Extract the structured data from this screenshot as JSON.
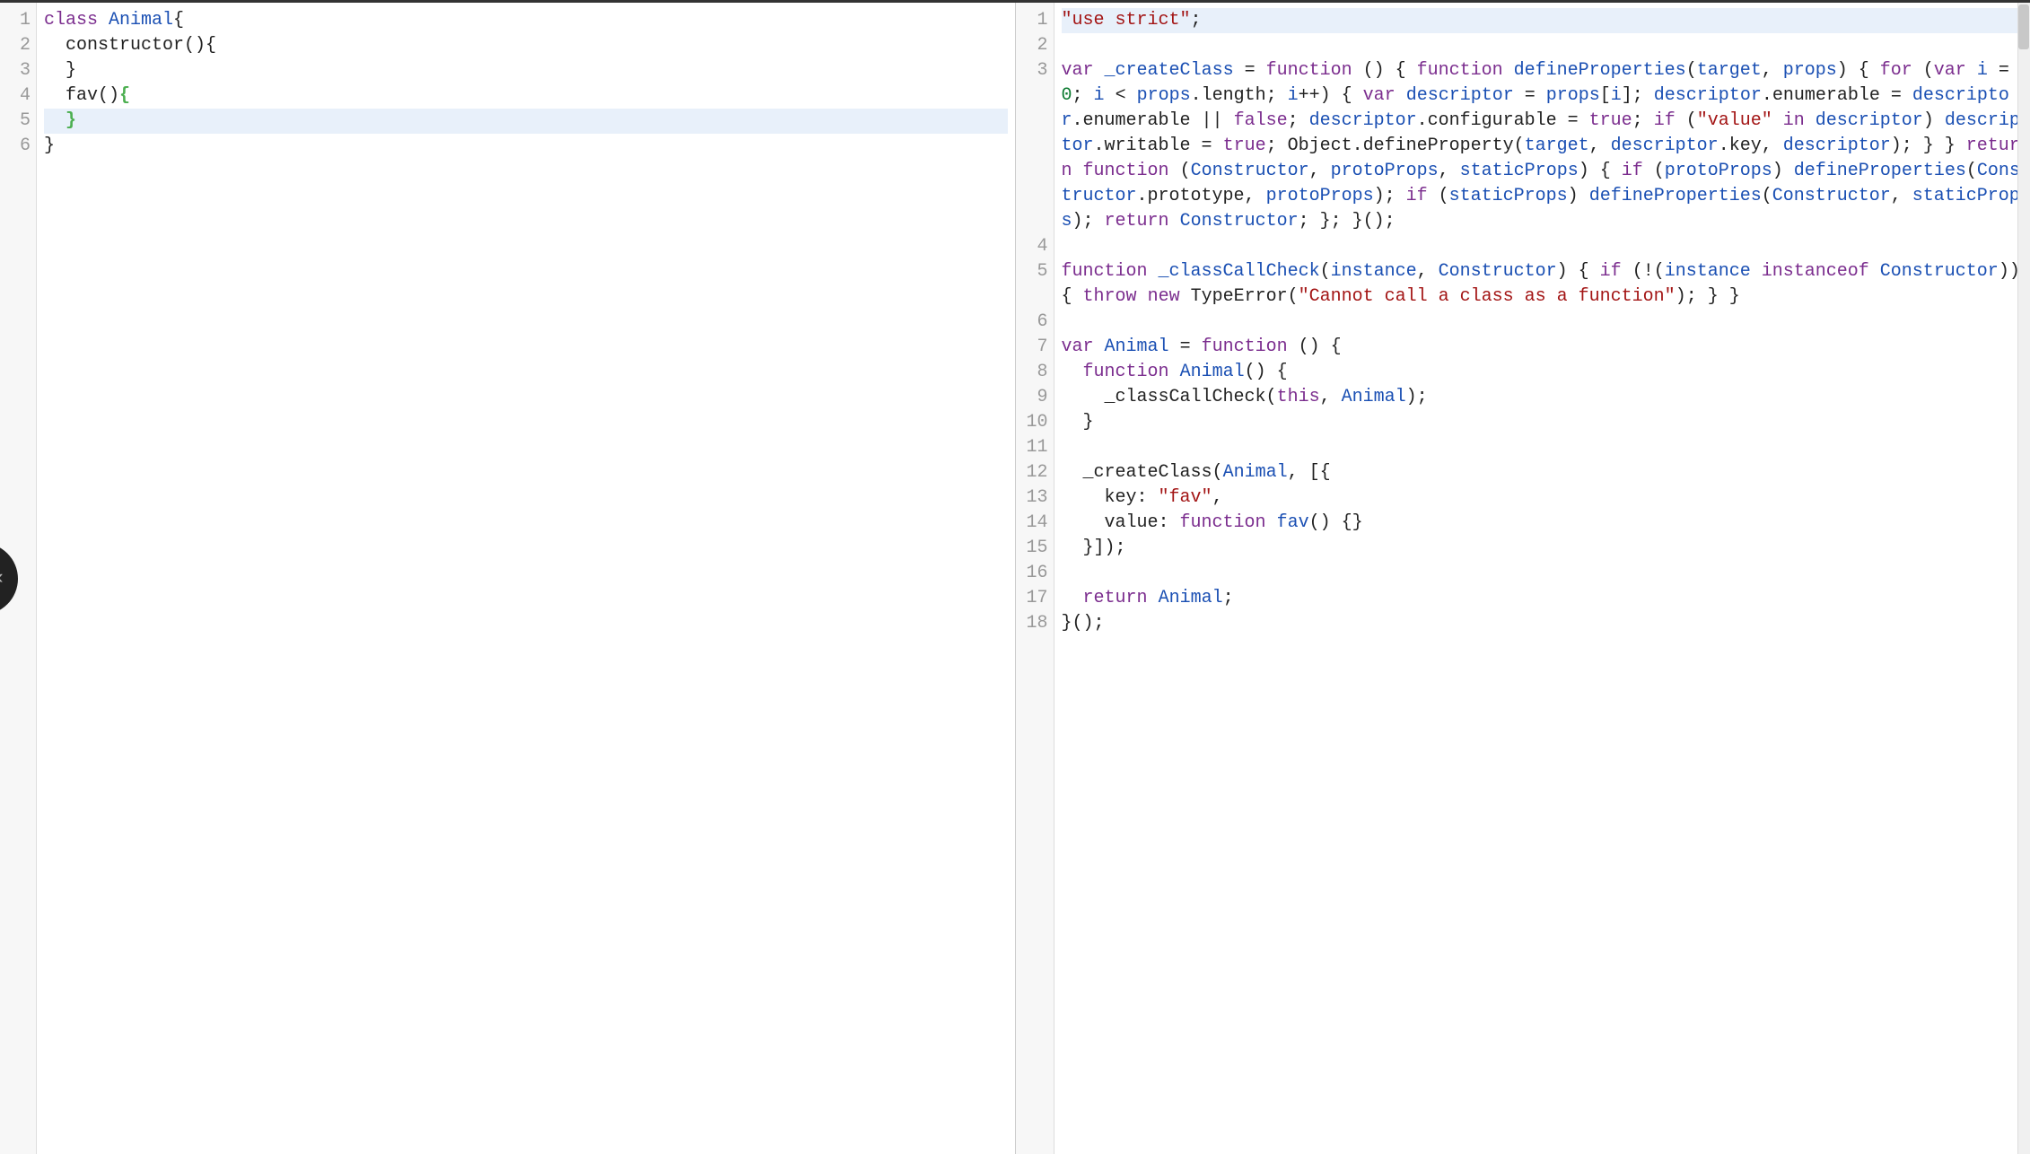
{
  "editor": {
    "leftPane": {
      "activeLine": 5,
      "lines": [
        [
          {
            "t": "class",
            "c": "tok-kw"
          },
          {
            "t": " "
          },
          {
            "t": "Animal",
            "c": "tok-def"
          },
          {
            "t": "{"
          }
        ],
        [
          {
            "t": "  constructor(){"
          }
        ],
        [
          {
            "t": "  }"
          }
        ],
        [
          {
            "t": "  fav()"
          },
          {
            "t": "{",
            "c": "tok-brace-match"
          }
        ],
        [
          {
            "t": "  "
          },
          {
            "t": "}",
            "c": "tok-brace-match"
          }
        ],
        [
          {
            "t": "}"
          }
        ]
      ]
    },
    "rightPane": {
      "activeLine": 1,
      "lines": [
        [
          {
            "t": "\"use strict\"",
            "c": "tok-str"
          },
          {
            "t": ";"
          }
        ],
        [],
        [
          {
            "t": "var",
            "c": "tok-kw"
          },
          {
            "t": " "
          },
          {
            "t": "_createClass",
            "c": "tok-var"
          },
          {
            "t": " = "
          },
          {
            "t": "function",
            "c": "tok-kw"
          },
          {
            "t": " () { "
          },
          {
            "t": "function",
            "c": "tok-kw"
          },
          {
            "t": " "
          },
          {
            "t": "defineProperties",
            "c": "tok-def"
          },
          {
            "t": "("
          },
          {
            "t": "target",
            "c": "tok-var"
          },
          {
            "t": ", "
          },
          {
            "t": "props",
            "c": "tok-var"
          },
          {
            "t": ") { "
          },
          {
            "t": "for",
            "c": "tok-kw"
          },
          {
            "t": " ("
          },
          {
            "t": "var",
            "c": "tok-kw"
          },
          {
            "t": " "
          },
          {
            "t": "i",
            "c": "tok-var"
          },
          {
            "t": " = "
          },
          {
            "t": "0",
            "c": "tok-num"
          },
          {
            "t": "; "
          },
          {
            "t": "i",
            "c": "tok-var"
          },
          {
            "t": " < "
          },
          {
            "t": "props",
            "c": "tok-var"
          },
          {
            "t": ".length; "
          },
          {
            "t": "i",
            "c": "tok-var"
          },
          {
            "t": "++) { "
          },
          {
            "t": "var",
            "c": "tok-kw"
          },
          {
            "t": " "
          },
          {
            "t": "descriptor",
            "c": "tok-var"
          },
          {
            "t": " = "
          },
          {
            "t": "props",
            "c": "tok-var"
          },
          {
            "t": "["
          },
          {
            "t": "i",
            "c": "tok-var"
          },
          {
            "t": "]; "
          },
          {
            "t": "descriptor",
            "c": "tok-var"
          },
          {
            "t": ".enumerable = "
          },
          {
            "t": "descriptor",
            "c": "tok-var"
          },
          {
            "t": ".enumerable || "
          },
          {
            "t": "false",
            "c": "tok-bool"
          },
          {
            "t": "; "
          },
          {
            "t": "descriptor",
            "c": "tok-var"
          },
          {
            "t": ".configurable = "
          },
          {
            "t": "true",
            "c": "tok-bool"
          },
          {
            "t": "; "
          },
          {
            "t": "if",
            "c": "tok-kw"
          },
          {
            "t": " ("
          },
          {
            "t": "\"value\"",
            "c": "tok-str"
          },
          {
            "t": " "
          },
          {
            "t": "in",
            "c": "tok-kw"
          },
          {
            "t": " "
          },
          {
            "t": "descriptor",
            "c": "tok-var"
          },
          {
            "t": ") "
          },
          {
            "t": "descriptor",
            "c": "tok-var"
          },
          {
            "t": ".writable = "
          },
          {
            "t": "true",
            "c": "tok-bool"
          },
          {
            "t": "; Object.defineProperty("
          },
          {
            "t": "target",
            "c": "tok-var"
          },
          {
            "t": ", "
          },
          {
            "t": "descriptor",
            "c": "tok-var"
          },
          {
            "t": ".key, "
          },
          {
            "t": "descriptor",
            "c": "tok-var"
          },
          {
            "t": "); } } "
          },
          {
            "t": "return",
            "c": "tok-kw"
          },
          {
            "t": " "
          },
          {
            "t": "function",
            "c": "tok-kw"
          },
          {
            "t": " ("
          },
          {
            "t": "Constructor",
            "c": "tok-var"
          },
          {
            "t": ", "
          },
          {
            "t": "protoProps",
            "c": "tok-var"
          },
          {
            "t": ", "
          },
          {
            "t": "staticProps",
            "c": "tok-var"
          },
          {
            "t": ") { "
          },
          {
            "t": "if",
            "c": "tok-kw"
          },
          {
            "t": " ("
          },
          {
            "t": "protoProps",
            "c": "tok-var"
          },
          {
            "t": ") "
          },
          {
            "t": "defineProperties",
            "c": "tok-var"
          },
          {
            "t": "("
          },
          {
            "t": "Constructor",
            "c": "tok-var"
          },
          {
            "t": ".prototype, "
          },
          {
            "t": "protoProps",
            "c": "tok-var"
          },
          {
            "t": "); "
          },
          {
            "t": "if",
            "c": "tok-kw"
          },
          {
            "t": " ("
          },
          {
            "t": "staticProps",
            "c": "tok-var"
          },
          {
            "t": ") "
          },
          {
            "t": "defineProperties",
            "c": "tok-var"
          },
          {
            "t": "("
          },
          {
            "t": "Constructor",
            "c": "tok-var"
          },
          {
            "t": ", "
          },
          {
            "t": "staticProps",
            "c": "tok-var"
          },
          {
            "t": "); "
          },
          {
            "t": "return",
            "c": "tok-kw"
          },
          {
            "t": " "
          },
          {
            "t": "Constructor",
            "c": "tok-var"
          },
          {
            "t": "; }; }();"
          }
        ],
        [],
        [
          {
            "t": "function",
            "c": "tok-kw"
          },
          {
            "t": " "
          },
          {
            "t": "_classCallCheck",
            "c": "tok-def"
          },
          {
            "t": "("
          },
          {
            "t": "instance",
            "c": "tok-var"
          },
          {
            "t": ", "
          },
          {
            "t": "Constructor",
            "c": "tok-var"
          },
          {
            "t": ") { "
          },
          {
            "t": "if",
            "c": "tok-kw"
          },
          {
            "t": " (!("
          },
          {
            "t": "instance",
            "c": "tok-var"
          },
          {
            "t": " "
          },
          {
            "t": "instanceof",
            "c": "tok-kw"
          },
          {
            "t": " "
          },
          {
            "t": "Constructor",
            "c": "tok-var"
          },
          {
            "t": ")) { "
          },
          {
            "t": "throw",
            "c": "tok-kw"
          },
          {
            "t": " "
          },
          {
            "t": "new",
            "c": "tok-kw"
          },
          {
            "t": " TypeError("
          },
          {
            "t": "\"Cannot call a class as a function\"",
            "c": "tok-str"
          },
          {
            "t": "); } }"
          }
        ],
        [],
        [
          {
            "t": "var",
            "c": "tok-kw"
          },
          {
            "t": " "
          },
          {
            "t": "Animal",
            "c": "tok-var"
          },
          {
            "t": " = "
          },
          {
            "t": "function",
            "c": "tok-kw"
          },
          {
            "t": " () {"
          }
        ],
        [
          {
            "t": "  "
          },
          {
            "t": "function",
            "c": "tok-kw"
          },
          {
            "t": " "
          },
          {
            "t": "Animal",
            "c": "tok-def"
          },
          {
            "t": "() {"
          }
        ],
        [
          {
            "t": "    _classCallCheck("
          },
          {
            "t": "this",
            "c": "tok-kw"
          },
          {
            "t": ", "
          },
          {
            "t": "Animal",
            "c": "tok-var"
          },
          {
            "t": ");"
          }
        ],
        [
          {
            "t": "  }"
          }
        ],
        [],
        [
          {
            "t": "  _createClass("
          },
          {
            "t": "Animal",
            "c": "tok-var"
          },
          {
            "t": ", [{"
          }
        ],
        [
          {
            "t": "    key: "
          },
          {
            "t": "\"fav\"",
            "c": "tok-str"
          },
          {
            "t": ","
          }
        ],
        [
          {
            "t": "    value: "
          },
          {
            "t": "function",
            "c": "tok-kw"
          },
          {
            "t": " "
          },
          {
            "t": "fav",
            "c": "tok-def"
          },
          {
            "t": "() {}"
          }
        ],
        [
          {
            "t": "  }]);"
          }
        ],
        [],
        [
          {
            "t": "  "
          },
          {
            "t": "return",
            "c": "tok-kw"
          },
          {
            "t": " "
          },
          {
            "t": "Animal",
            "c": "tok-var"
          },
          {
            "t": ";"
          }
        ],
        [
          {
            "t": "}();"
          }
        ]
      ]
    }
  },
  "handle": {
    "glyph": "‹"
  }
}
